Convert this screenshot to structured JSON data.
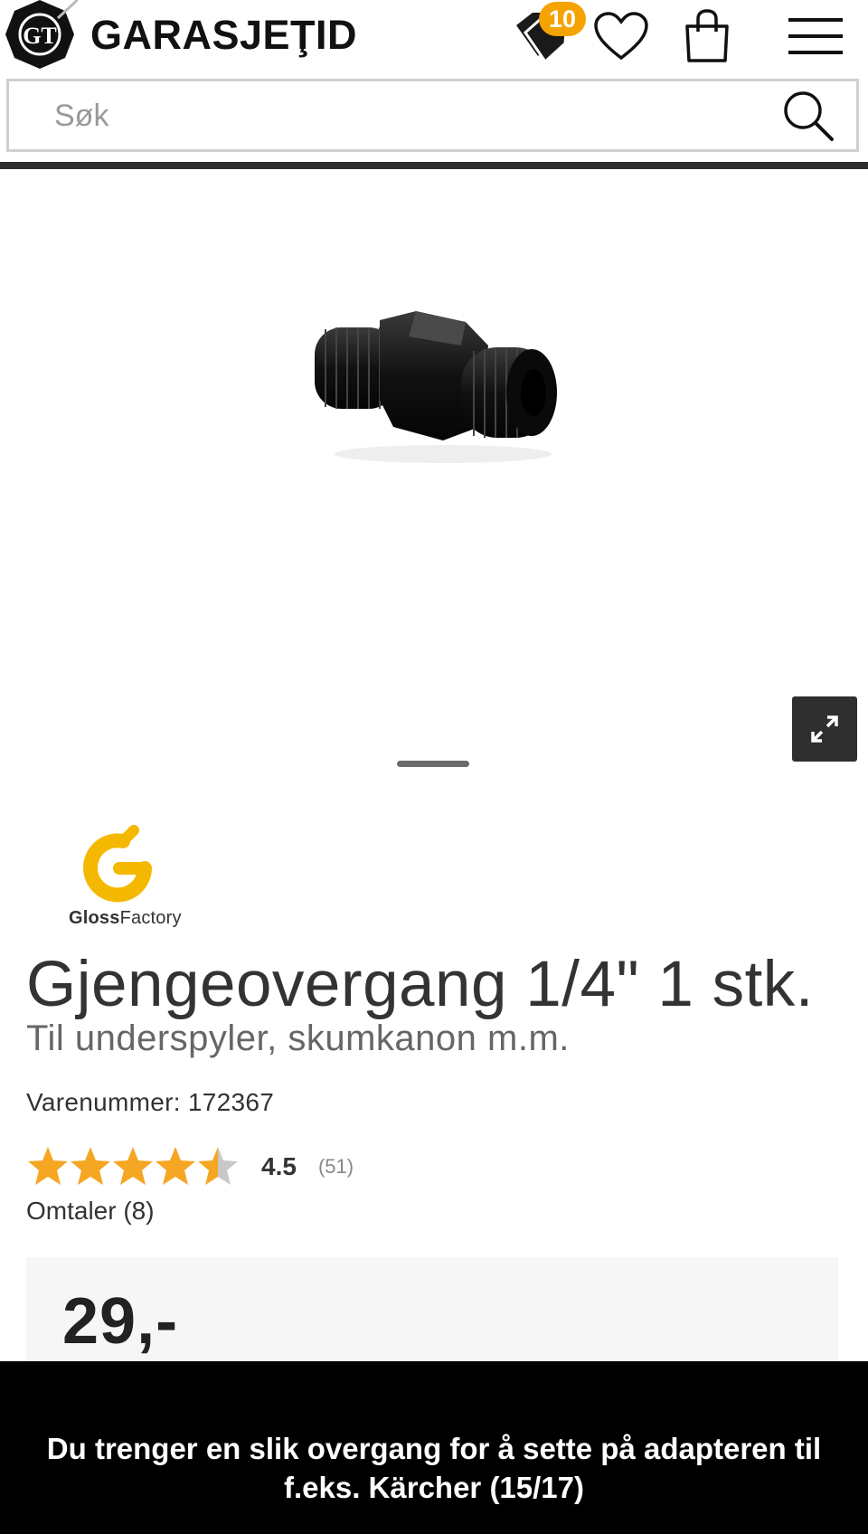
{
  "header": {
    "logo_text": "GARASJEŢID",
    "logo_monogram": "GT",
    "deals_badge": "10",
    "icons": [
      "tag-icon",
      "heart-icon",
      "bag-icon",
      "menu-icon"
    ]
  },
  "search": {
    "placeholder": "Søk"
  },
  "product": {
    "brand": {
      "bold": "Gloss",
      "light": "Factory",
      "accent": "#f5b800"
    },
    "title": "Gjengeovergang 1/4\" 1 stk.",
    "subtitle": "Til underspyler, skumkanon m.m.",
    "sku": "Varenummer: 172367",
    "rating": {
      "value": "4.5",
      "count": "(51)",
      "stars": 4.5
    },
    "reviews": "Omtaler (8)",
    "price": "29,-"
  },
  "toast": {
    "text": "Du trenger en slik overgang for å sette på adapteren til f.eks. Kärcher (15/17)"
  },
  "colors": {
    "accent": "#f5a300",
    "star": "#f5a623",
    "dark": "#2e2e2e"
  }
}
